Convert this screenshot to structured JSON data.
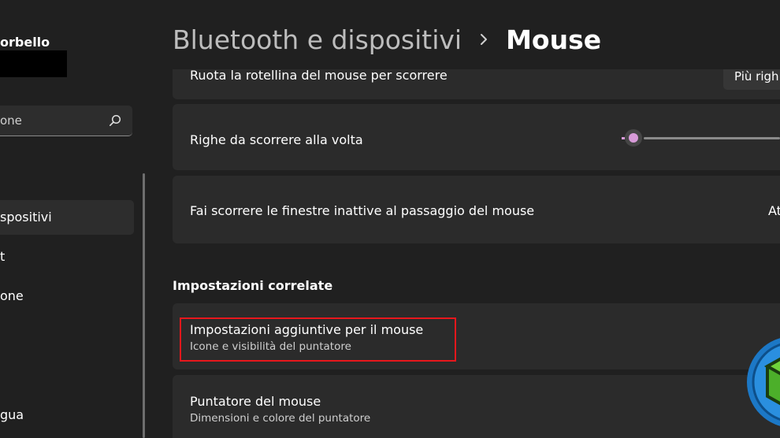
{
  "sidebar": {
    "user_name": "orbello",
    "search_placeholder": "one",
    "items": [
      {
        "label": "spositivi",
        "active": true
      },
      {
        "label": "t",
        "active": false
      },
      {
        "label": "one",
        "active": false
      },
      {
        "label": "gua",
        "active": false
      }
    ]
  },
  "header": {
    "parent": "Bluetooth e dispositivi",
    "current": "Mouse"
  },
  "settings": {
    "wheel_scroll": {
      "label": "Ruota la rotellina del mouse per scorrere",
      "value": "Più righ"
    },
    "lines_to_scroll": {
      "label": "Righe da scorrere alla volta",
      "slider_fraction": 0.03
    },
    "inactive_scroll": {
      "label": "Fai scorrere le finestre inattive al passaggio del mouse",
      "value": "At"
    }
  },
  "related": {
    "section_title": "Impostazioni correlate",
    "items": [
      {
        "title": "Impostazioni aggiuntive per il mouse",
        "subtitle": "Icone e visibilità del puntatore"
      },
      {
        "title": "Puntatore del mouse",
        "subtitle": "Dimensioni e colore del puntatore"
      }
    ]
  },
  "colors": {
    "accent": "#d79ad8",
    "highlight": "#e8171c",
    "background": "#202020",
    "card": "#2b2b2b"
  },
  "icons": [
    "search-icon",
    "chevron-right-icon",
    "watermark-logo"
  ]
}
